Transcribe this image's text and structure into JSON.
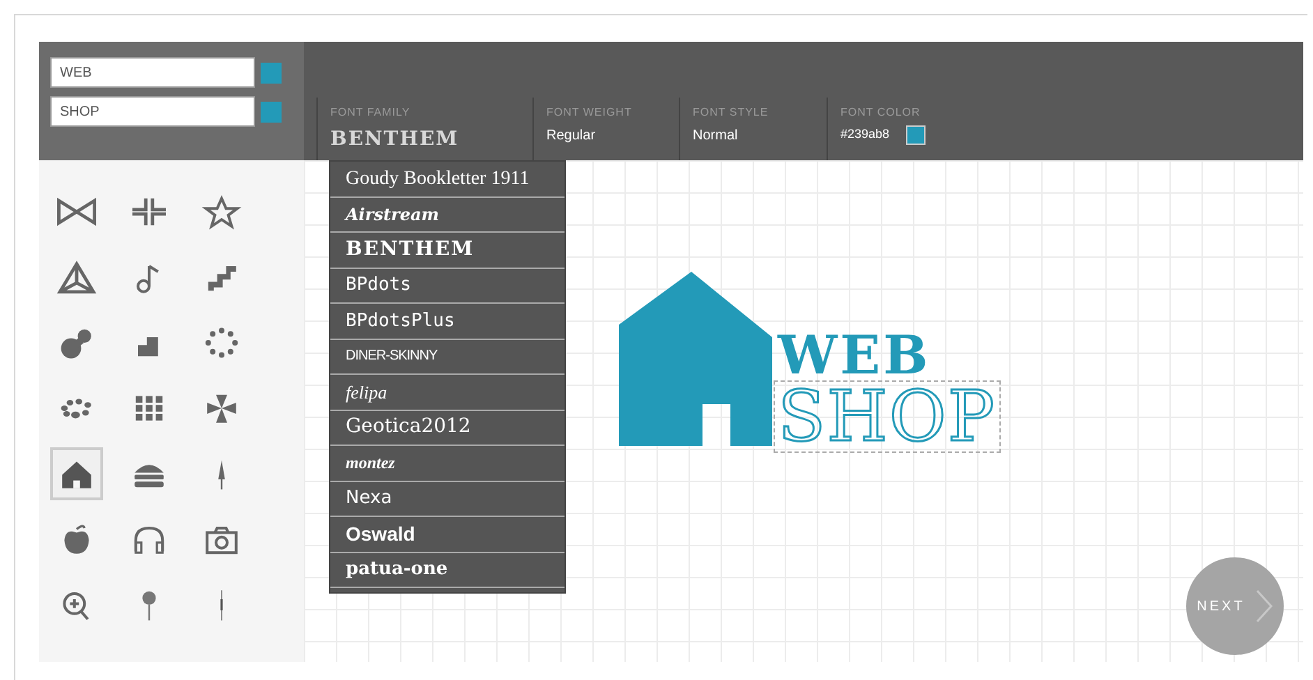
{
  "text_fields": [
    {
      "value": "WEB"
    },
    {
      "value": "SHOP"
    }
  ],
  "font_settings": [
    {
      "label": "FONT FAMILY",
      "value": "BENTHEM",
      "kind": "family"
    },
    {
      "label": "FONT WEIGHT",
      "value": "Regular",
      "kind": "text"
    },
    {
      "label": "FONT STYLE",
      "value": "Normal",
      "kind": "text"
    },
    {
      "label": "FONT COLOR",
      "value": "#239ab8",
      "kind": "color"
    }
  ],
  "font_options": [
    "Goudy Bookletter 1911",
    "Airstream",
    "BENTHEM",
    "BPdots",
    "BPdotsPlus",
    "DINER-SKINNY",
    "felipa",
    "Geotica2012",
    "montez",
    "Nexa",
    "Oswald",
    "patua-one"
  ],
  "shape_icons": [
    {
      "selected": false
    },
    {
      "selected": false
    },
    {
      "selected": false
    },
    {
      "selected": false
    },
    {
      "selected": false
    },
    {
      "selected": false
    },
    {
      "selected": false
    },
    {
      "selected": false
    },
    {
      "selected": false
    },
    {
      "selected": false
    },
    {
      "selected": false
    },
    {
      "selected": false
    },
    {
      "selected": true
    },
    {
      "selected": false
    },
    {
      "selected": false
    },
    {
      "selected": false
    },
    {
      "selected": false
    },
    {
      "selected": false
    },
    {
      "selected": false
    },
    {
      "selected": false
    },
    {
      "selected": false
    }
  ],
  "logo": {
    "lines": [
      {
        "text": "WEB",
        "selected": false
      },
      {
        "text": "SHOP",
        "selected": true
      }
    ]
  },
  "next_button": {
    "label": "NEXT"
  }
}
